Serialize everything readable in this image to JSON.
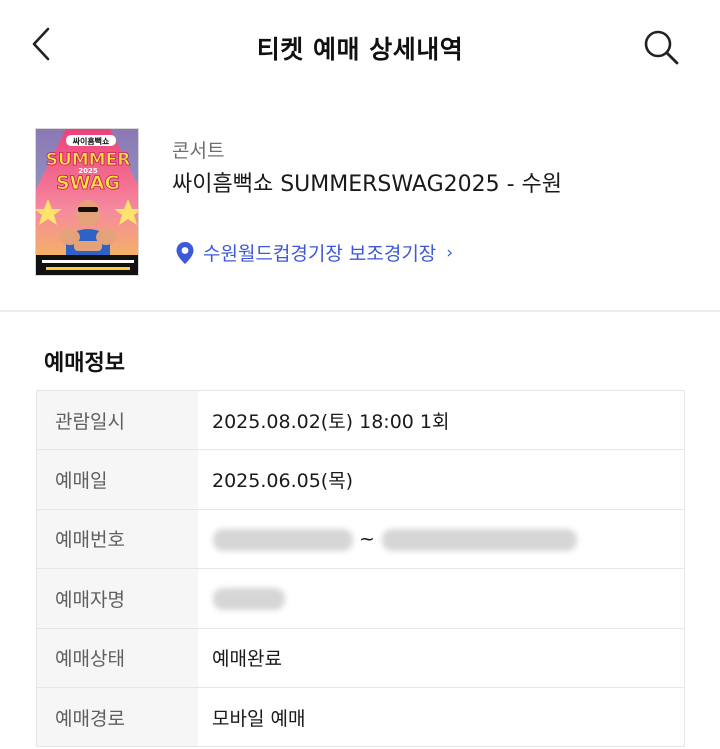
{
  "header": {
    "title": "티켓 예매 상세내역",
    "back_icon": "chevron-left-icon",
    "search_icon": "search-icon"
  },
  "event": {
    "category": "콘서트",
    "title": "싸이흠뻑쇼 SUMMERSWAG2025 - 수원",
    "venue": "수원월드컵경기장 보조경기장",
    "venue_arrow": "›",
    "poster": {
      "badge": "싸이흠뻑쇼",
      "line1": "SUMMER",
      "year": "2025",
      "line2": "SWAG"
    }
  },
  "booking_info": {
    "title": "예매정보",
    "rows": [
      {
        "label": "관람일시",
        "value": "2025.08.02(토) 18:00 1회"
      },
      {
        "label": "예매일",
        "value": "2025.06.05(목)"
      },
      {
        "label": "예매번호",
        "value": "~"
      },
      {
        "label": "예매자명",
        "value": ""
      },
      {
        "label": "예매상태",
        "value": "예매완료"
      },
      {
        "label": "예매경로",
        "value": "모바일 예매"
      }
    ]
  },
  "colors": {
    "accent": "#3d58d8",
    "label_bg": "#f6f6f6",
    "border": "#e6e6e6"
  }
}
